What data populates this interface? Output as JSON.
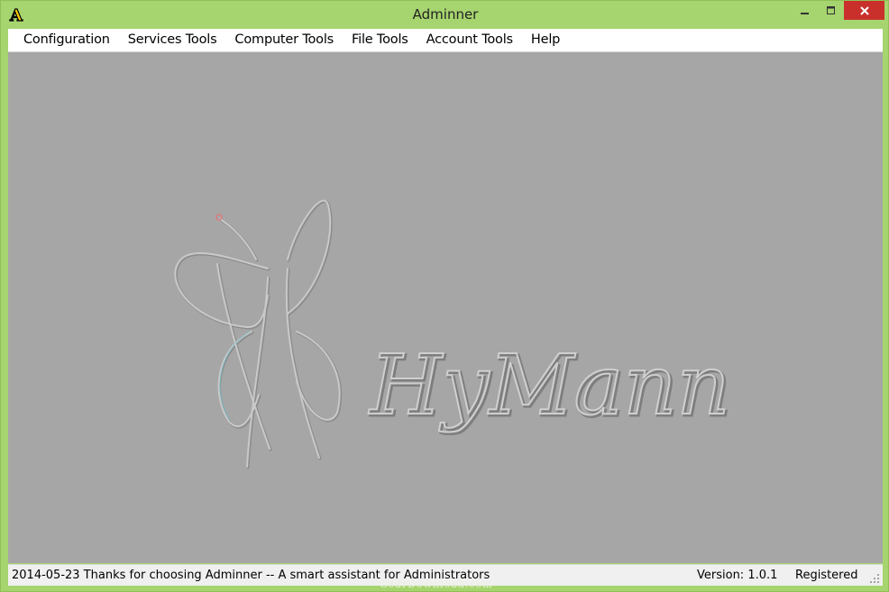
{
  "window": {
    "title": "Adminner",
    "app_icon_letter": "A"
  },
  "menu": [
    "Configuration",
    "Services Tools",
    "Computer Tools",
    "File Tools",
    "Account Tools",
    "Help"
  ],
  "brand": {
    "logo_text": "HyMann"
  },
  "status": {
    "message": "2014-05-23  Thanks for choosing Adminner -- A smart assistant for Administrators",
    "version": "Version: 1.0.1",
    "registration": "Registered"
  },
  "watermark": "GearDownload.com",
  "colors": {
    "frame": "#a6d46e",
    "client": "#a6a6a6",
    "close": "#c9302c"
  }
}
